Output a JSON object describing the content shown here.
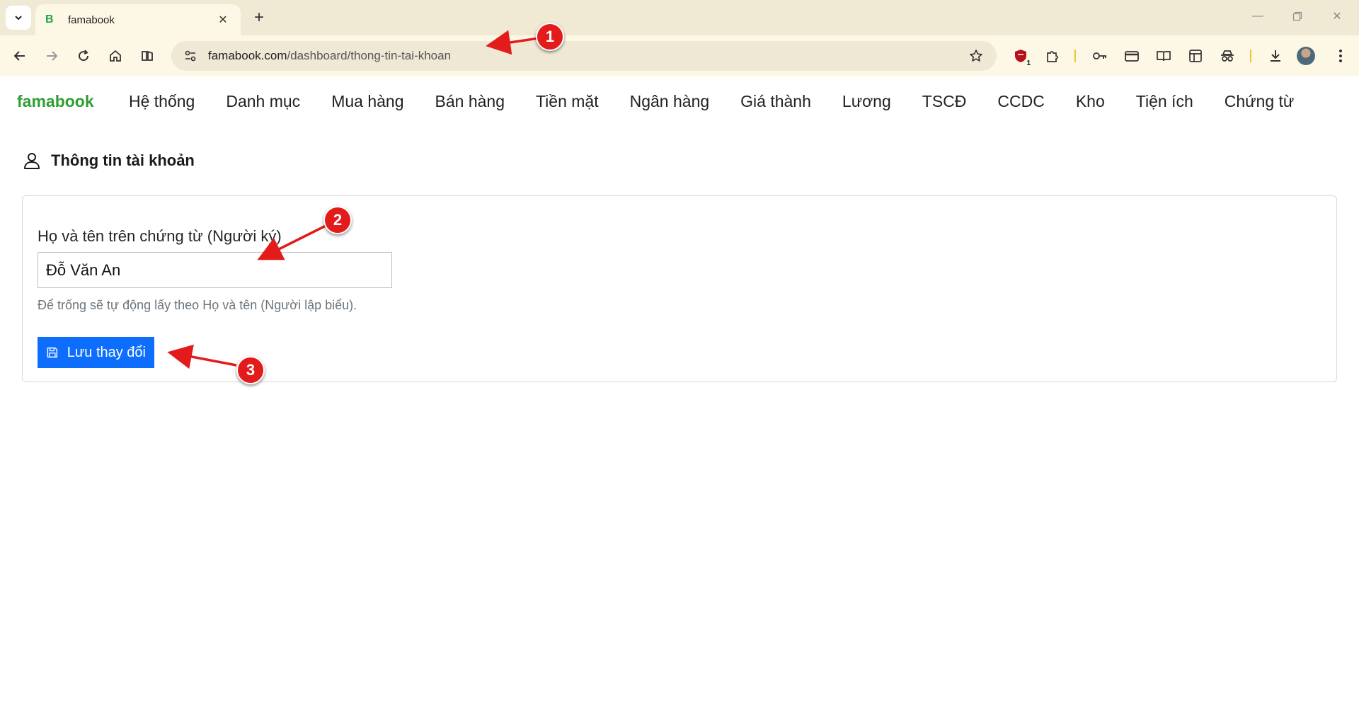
{
  "browser": {
    "tab": {
      "favicon_letter": "B",
      "title": "famabook"
    },
    "address": {
      "domain": "famabook.com",
      "path": "/dashboard/thong-tin-tai-khoan"
    },
    "extension_badge": "1"
  },
  "app": {
    "brand": "famabook",
    "menu": [
      "Hệ thống",
      "Danh mục",
      "Mua hàng",
      "Bán hàng",
      "Tiền mặt",
      "Ngân hàng",
      "Giá thành",
      "Lương",
      "TSCĐ",
      "CCDC",
      "Kho",
      "Tiện ích",
      "Chứng từ"
    ]
  },
  "page": {
    "title": "Thông tin tài khoản",
    "form": {
      "label": "Họ và tên trên chứng từ (Người ký)",
      "value": "Đỗ Văn An",
      "helper": "Để trống sẽ tự động lấy theo Họ và tên (Người lập biểu).",
      "save_label": "Lưu thay đổi"
    }
  },
  "annotations": [
    "1",
    "2",
    "3"
  ],
  "colors": {
    "brand": "#2f9e33",
    "primary": "#0d6efd",
    "annotation": "#e31b1b"
  }
}
